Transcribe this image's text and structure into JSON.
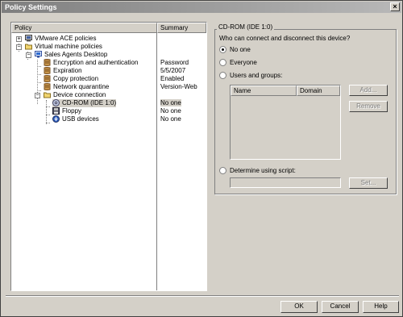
{
  "window": {
    "title": "Policy Settings",
    "close_label": "×"
  },
  "tree": {
    "headers": {
      "policy": "Policy",
      "summary": "Summary"
    },
    "nodes": [
      {
        "label": "VMware ACE policies",
        "summary": "",
        "icon": "computer-icon",
        "expander": "+"
      },
      {
        "label": "Virtual machine policies",
        "summary": "",
        "icon": "folder-icon",
        "expander": "−"
      },
      {
        "label": "Sales Agents Desktop",
        "summary": "",
        "icon": "virtual-machine-icon",
        "expander": "−"
      },
      {
        "label": "Encryption and authentication",
        "summary": "Password",
        "icon": "policy-icon"
      },
      {
        "label": "Expiration",
        "summary": "5/5/2007",
        "icon": "policy-icon"
      },
      {
        "label": "Copy protection",
        "summary": "Enabled",
        "icon": "policy-icon"
      },
      {
        "label": "Network quarantine",
        "summary": "Version-Web",
        "icon": "policy-icon"
      },
      {
        "label": "Device connection",
        "summary": "",
        "icon": "folder-icon",
        "expander": "−"
      },
      {
        "label": "CD-ROM (IDE 1:0)",
        "summary": "No one",
        "icon": "cdrom-icon",
        "selected": true
      },
      {
        "label": "Floppy",
        "summary": "No one",
        "icon": "floppy-icon"
      },
      {
        "label": "USB devices",
        "summary": "No one",
        "icon": "usb-icon"
      }
    ]
  },
  "settings": {
    "group_title": "CD-ROM (IDE 1:0)",
    "question": "Who can connect and disconnect this device?",
    "options": {
      "no_one": "No one",
      "everyone": "Everyone",
      "users_groups": "Users and groups:",
      "script": "Determine using script:"
    },
    "selected_option": "no_one",
    "users_columns": {
      "name": "Name",
      "domain": "Domain"
    },
    "buttons": {
      "add": "Add...",
      "remove": "Remove",
      "set": "Set..."
    }
  },
  "footer": {
    "ok": "OK",
    "cancel": "Cancel",
    "help": "Help"
  },
  "colors": {
    "selected_bg": "#d4d0c8",
    "policy_icon": "#c8964b",
    "folder_icon": "#f0d470"
  }
}
